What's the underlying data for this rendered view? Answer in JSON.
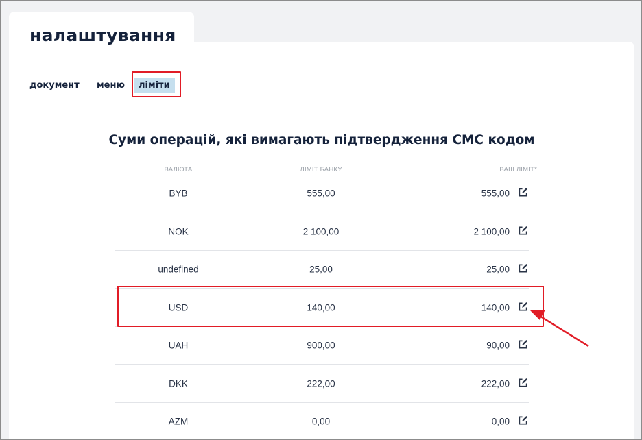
{
  "page": {
    "title": "налаштування"
  },
  "tabs": [
    {
      "label": "документ",
      "active": false
    },
    {
      "label": "меню",
      "active": false
    },
    {
      "label": "ліміти",
      "active": true
    }
  ],
  "section": {
    "title": "Суми операцій, які вимагають підтвердження СМС кодом"
  },
  "table": {
    "headers": {
      "currency": "ВАЛЮТА",
      "bank_limit": "ЛІМІТ БАНКУ",
      "user_limit": "ВАШ ЛІМІТ*"
    },
    "rows": [
      {
        "currency": "BYB",
        "bank_limit": "555,00",
        "user_limit": "555,00"
      },
      {
        "currency": "NOK",
        "bank_limit": "2 100,00",
        "user_limit": "2 100,00"
      },
      {
        "currency": "undefined",
        "bank_limit": "25,00",
        "user_limit": "25,00"
      },
      {
        "currency": "USD",
        "bank_limit": "140,00",
        "user_limit": "140,00"
      },
      {
        "currency": "UAH",
        "bank_limit": "900,00",
        "user_limit": "90,00"
      },
      {
        "currency": "DKK",
        "bank_limit": "222,00",
        "user_limit": "222,00"
      },
      {
        "currency": "AZM",
        "bank_limit": "0,00",
        "user_limit": "0,00"
      }
    ]
  },
  "colors": {
    "accent": "#c5dfee",
    "annotation": "#e11c26",
    "text": "#15223b"
  },
  "icons": {
    "edit": "edit-icon"
  }
}
